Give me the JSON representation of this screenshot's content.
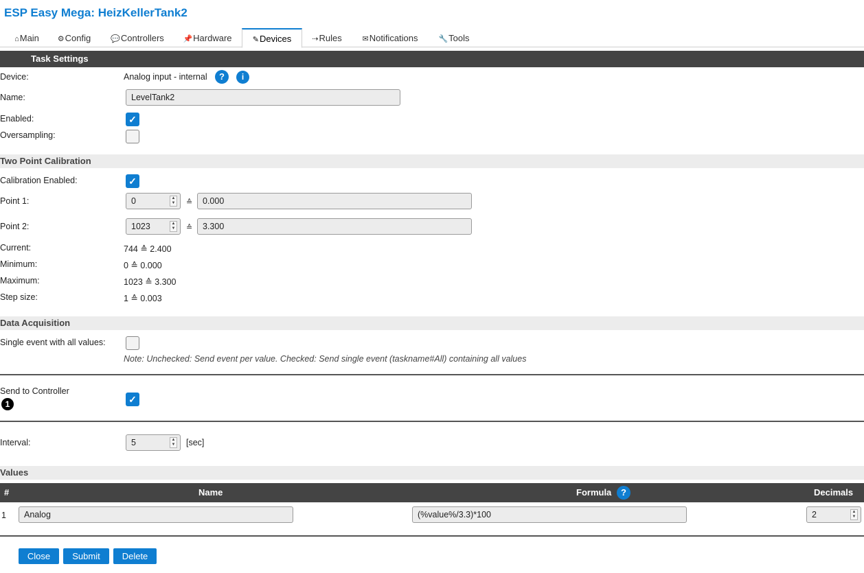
{
  "app_title": "ESP Easy Mega: HeizKellerTank2",
  "tabs": [
    {
      "icon": "⌂",
      "label": "Main"
    },
    {
      "icon": "⚙",
      "label": "Config"
    },
    {
      "icon": "💬",
      "label": "Controllers"
    },
    {
      "icon": "📌",
      "label": "Hardware"
    },
    {
      "icon": "✎",
      "label": "Devices"
    },
    {
      "icon": "⇢",
      "label": "Rules"
    },
    {
      "icon": "✉",
      "label": "Notifications"
    },
    {
      "icon": "🔧",
      "label": "Tools"
    }
  ],
  "active_tab": "Devices",
  "task_settings": {
    "header": "Task Settings",
    "device_label": "Device:",
    "device_value": "Analog input - internal",
    "help_icon": "?",
    "info_icon": "i",
    "name_label": "Name:",
    "name_value": "LevelTank2",
    "enabled_label": "Enabled:",
    "enabled": true,
    "oversampling_label": "Oversampling:",
    "oversampling": false
  },
  "calibration": {
    "header": "Two Point Calibration",
    "enabled_label": "Calibration Enabled:",
    "enabled": true,
    "eq_symbol": "≙",
    "point1_label": "Point 1:",
    "point1_adc": "0",
    "point1_value": "0.000",
    "point2_label": "Point 2:",
    "point2_adc": "1023",
    "point2_value": "3.300",
    "current_label": "Current:",
    "current_value": "744 ≙ 2.400",
    "minimum_label": "Minimum:",
    "minimum_value": "0 ≙ 0.000",
    "maximum_label": "Maximum:",
    "maximum_value": "1023 ≙ 3.300",
    "step_label": "Step size:",
    "step_value": "1 ≙ 0.003"
  },
  "data_acquisition": {
    "header": "Data Acquisition",
    "single_event_label": "Single event with all values:",
    "single_event": false,
    "note": "Note: Unchecked: Send event per value. Checked: Send single event (taskname#All) containing all values",
    "send_label": "Send to Controller",
    "controller_badge": "1",
    "send_enabled": true,
    "interval_label": "Interval:",
    "interval_value": "5",
    "interval_unit": "[sec]"
  },
  "values": {
    "header": "Values",
    "columns": {
      "index": "#",
      "name": "Name",
      "formula": "Formula",
      "formula_help": "?",
      "decimals": "Decimals"
    },
    "rows": [
      {
        "index": "1",
        "name": "Analog",
        "formula": "(%value%/3.3)*100",
        "decimals": "2"
      }
    ]
  },
  "buttons": {
    "close": "Close",
    "submit": "Submit",
    "delete": "Delete"
  },
  "colors": {
    "accent": "#0f7ed1",
    "header_bar": "#444444",
    "section_bg": "#ececec"
  }
}
